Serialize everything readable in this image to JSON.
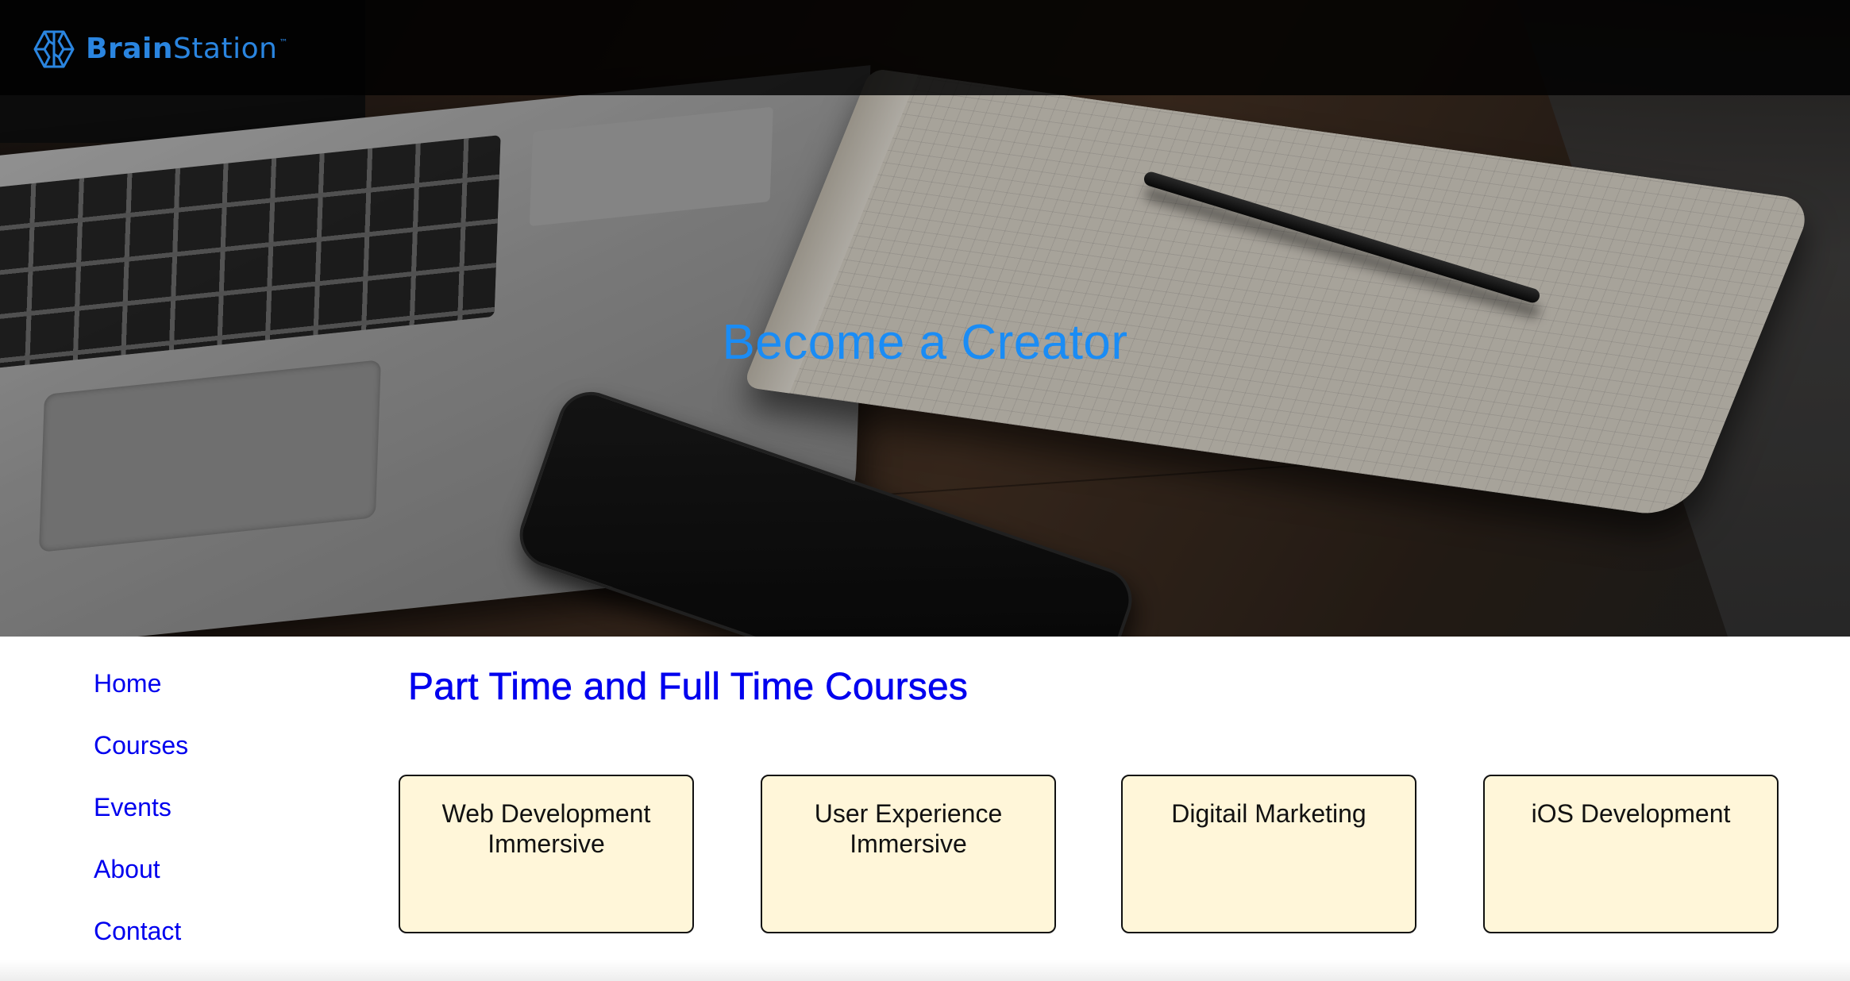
{
  "brand": {
    "name_bold": "Brain",
    "name_regular": "Station",
    "trademark": "™",
    "icon": "brain-logo-icon",
    "color": "#2a85e0"
  },
  "hero": {
    "headline": "Become a Creator",
    "headline_color": "#1a8cf5"
  },
  "nav": {
    "items": [
      {
        "label": "Home"
      },
      {
        "label": "Courses"
      },
      {
        "label": "Events"
      },
      {
        "label": "About"
      },
      {
        "label": "Contact"
      }
    ],
    "link_color": "#0000ee"
  },
  "main": {
    "title": "Part Time and Full Time Courses",
    "courses": [
      {
        "line1": "Web Development",
        "line2": "Immersive"
      },
      {
        "line1": "User Experience",
        "line2": "Immersive"
      },
      {
        "line1": "Digitail Marketing",
        "line2": ""
      },
      {
        "line1": "iOS Development",
        "line2": ""
      }
    ],
    "card_color": "#fff6d9"
  }
}
